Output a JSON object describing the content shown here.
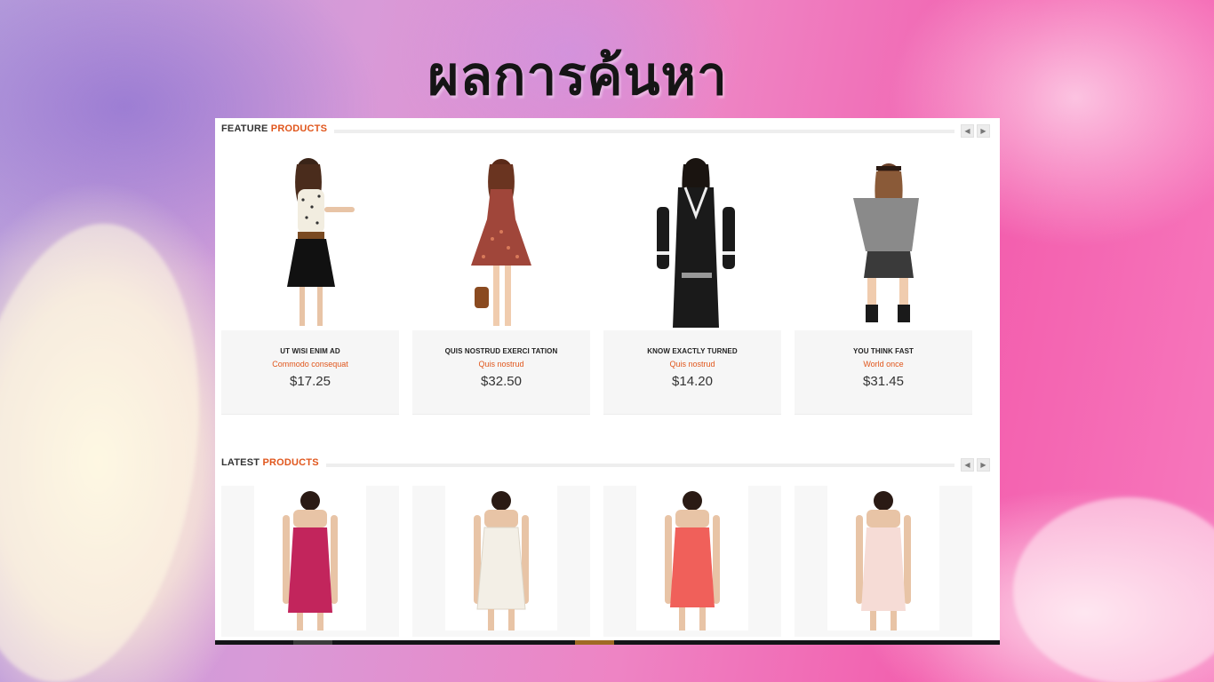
{
  "slide": {
    "title": "ผลการค้นหา"
  },
  "feature": {
    "title_prefix": "FEATURE",
    "title_accent": "PRODUCTS",
    "prev": "◀",
    "next": "▶",
    "products": [
      {
        "name": "UT WISI ENIM AD",
        "subtitle": "Commodo consequat",
        "price": "$17.25",
        "dress": "#111111",
        "top": "#f2ede0"
      },
      {
        "name": "QUIS NOSTRUD EXERCI TATION",
        "subtitle": "Quis nostrud",
        "price": "$32.50",
        "dress": "#a0463a",
        "top": "#a0463a"
      },
      {
        "name": "KNOW EXACTLY TURNED",
        "subtitle": "Quis nostrud",
        "price": "$14.20",
        "dress": "#1a1a1a",
        "top": "#1a1a1a"
      },
      {
        "name": "YOU THINK FAST",
        "subtitle": "World once",
        "price": "$31.45",
        "dress": "#3a3a3a",
        "top": "#8a8a8a"
      }
    ]
  },
  "latest": {
    "title_prefix": "LATEST",
    "title_accent": "PRODUCTS",
    "prev": "◀",
    "next": "▶",
    "products": [
      {
        "color": "#c2255c"
      },
      {
        "color": "#f3efe6"
      },
      {
        "color": "#f0605a"
      },
      {
        "color": "#f6dcd6"
      }
    ]
  },
  "colors": {
    "accent": "#e0561c",
    "card_bg": "#f6f6f6"
  }
}
